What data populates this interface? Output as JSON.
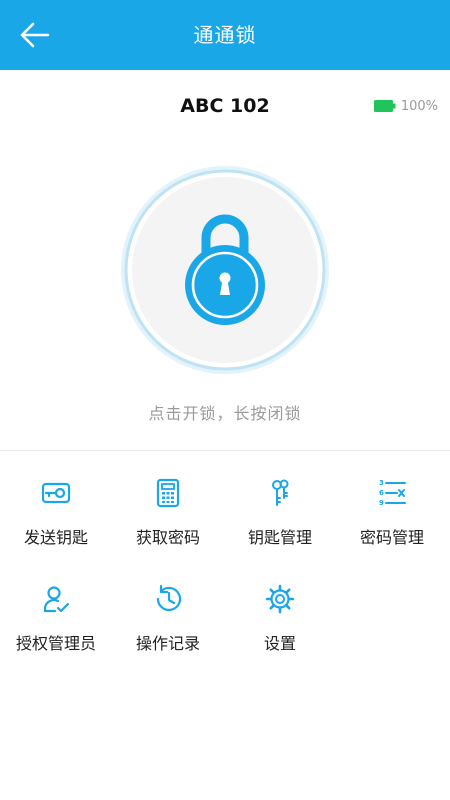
{
  "header": {
    "title": "通通锁"
  },
  "device": {
    "name": "ABC 102",
    "battery": "100%"
  },
  "lock": {
    "hint": "点击开锁，长按闭锁"
  },
  "colors": {
    "accent": "#1aa7e8",
    "battery": "#21c45b"
  },
  "menu": [
    {
      "label": "发送钥匙",
      "icon": "send-key-icon"
    },
    {
      "label": "获取密码",
      "icon": "calculator-icon"
    },
    {
      "label": "钥匙管理",
      "icon": "keys-icon"
    },
    {
      "label": "密码管理",
      "icon": "password-list-icon"
    },
    {
      "label": "授权管理员",
      "icon": "admin-user-icon"
    },
    {
      "label": "操作记录",
      "icon": "history-icon"
    },
    {
      "label": "设置",
      "icon": "gear-icon"
    }
  ]
}
